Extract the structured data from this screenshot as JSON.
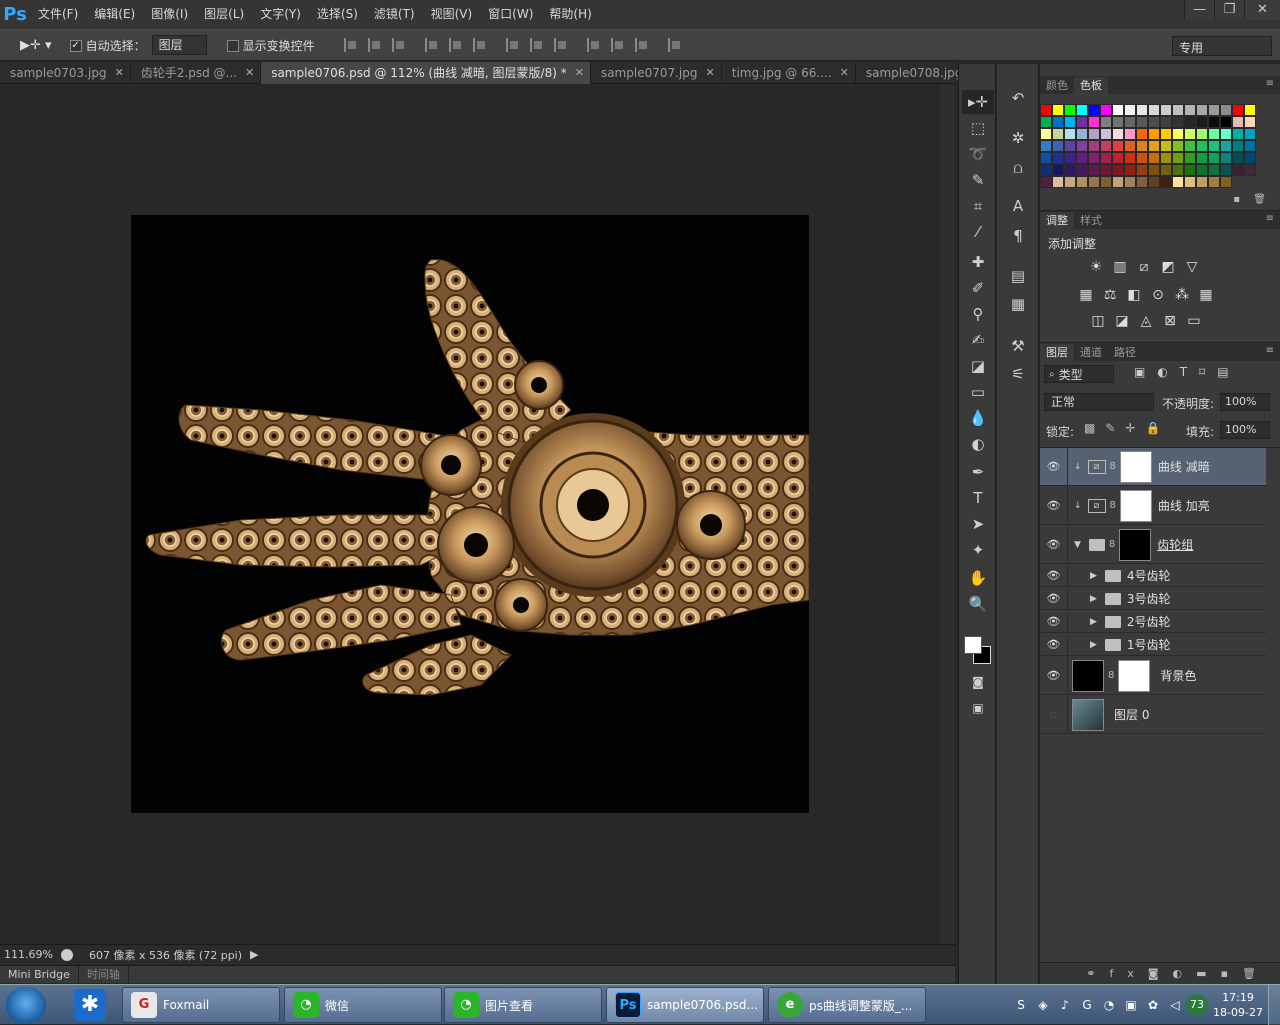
{
  "app": {
    "logo": "Ps"
  },
  "menu": [
    "文件(F)",
    "编辑(E)",
    "图像(I)",
    "图层(L)",
    "文字(Y)",
    "选择(S)",
    "滤镜(T)",
    "视图(V)",
    "窗口(W)",
    "帮助(H)"
  ],
  "window_controls": {
    "minimize": "—",
    "restore": "❐",
    "close": "✕"
  },
  "options": {
    "auto_select_label": "自动选择：",
    "auto_select_value": "图层",
    "show_transform_label": "显示变换控件",
    "workspace": "专用"
  },
  "tabs": [
    {
      "label": "sample0703.jpg",
      "active": false
    },
    {
      "label": "齿轮手2.psd @...",
      "active": false
    },
    {
      "label": "sample0706.psd @ 112% (曲线 减暗, 图层蒙版/8) *",
      "active": true
    },
    {
      "label": "sample0707.jpg",
      "active": false
    },
    {
      "label": "timg.jpg @ 66....",
      "active": false
    },
    {
      "label": "sample0708.jpg",
      "active": false
    }
  ],
  "status": {
    "zoom": "111.69%",
    "doc_size": "607 像素 x 536 像素 (72 ppi)"
  },
  "bottom_tabs": [
    "Mini Bridge",
    "时间轴"
  ],
  "panels": {
    "color_tabs": [
      "颜色",
      "色板"
    ],
    "adjust_tabs": [
      "调整",
      "样式"
    ],
    "adjust_title": "添加调整",
    "layer_tabs": [
      "图层",
      "通道",
      "路径"
    ],
    "filter_kind": "类型",
    "blend_mode": "正常",
    "opacity_label": "不透明度:",
    "opacity_value": "100%",
    "lock_label": "锁定:",
    "fill_label": "填充:",
    "fill_value": "100%"
  },
  "swatch_colors": [
    "#ff0000",
    "#ffff00",
    "#00ff00",
    "#00ffff",
    "#0000ff",
    "#ff00ff",
    "#ffffff",
    "#f2f2f2",
    "#e6e6e6",
    "#d9d9d9",
    "#cccccc",
    "#bfbfbf",
    "#b3b3b3",
    "#a6a6a6",
    "#999999",
    "#8c8c8c",
    "#ff0000",
    "#ffff00",
    "#00b050",
    "#0070c0",
    "#00b0f0",
    "#7030a0",
    "#ff33cc",
    "#808080",
    "#737373",
    "#666666",
    "#595959",
    "#4d4d4d",
    "#404040",
    "#333333",
    "#262626",
    "#1a1a1a",
    "#0d0d0d",
    "#000000",
    "#e6b8b7",
    "#fcd5b4",
    "#ffff99",
    "#c4d79b",
    "#b7dee8",
    "#95b3d7",
    "#b1a0c7",
    "#ccc0da",
    "#f2dcdb",
    "#ff99cc",
    "#ff6600",
    "#ff9900",
    "#ffcc00",
    "#ffff66",
    "#ccff66",
    "#99ff66",
    "#66ff99",
    "#66ffcc",
    "#00b0a0",
    "#00a0c0",
    "#3080c0",
    "#4060b0",
    "#6040a0",
    "#8040a0",
    "#a04080",
    "#c04060",
    "#e04040",
    "#e06020",
    "#e08020",
    "#e0a020",
    "#c0c020",
    "#80c020",
    "#40c040",
    "#20c060",
    "#20c080",
    "#20a0a0",
    "#008080",
    "#0070a0",
    "#1050a0",
    "#203090",
    "#402090",
    "#602080",
    "#802070",
    "#a02050",
    "#c02030",
    "#d03010",
    "#d05010",
    "#c07010",
    "#a09010",
    "#70a010",
    "#30a020",
    "#10a040",
    "#10a060",
    "#108080",
    "#005050",
    "#004870",
    "#103070",
    "#181860",
    "#301860",
    "#481860",
    "#601850",
    "#701830",
    "#801820",
    "#902010",
    "#904010",
    "#805010",
    "#706010",
    "#507010",
    "#207010",
    "#107030",
    "#107040",
    "#105050",
    "#3a2030",
    "#402838",
    "#502040",
    "#d9c0a0",
    "#c8a880",
    "#b09060",
    "#987848",
    "#806030",
    "#c0a080",
    "#a08060",
    "#806040",
    "#604020",
    "#402010",
    "#ffe0a0",
    "#e0c080",
    "#c0a060",
    "#a08040",
    "#806020"
  ],
  "layers": [
    {
      "name": "曲线 减暗",
      "type": "curves",
      "selected": true,
      "visible": true
    },
    {
      "name": "曲线 加亮",
      "type": "curves",
      "selected": false,
      "visible": true
    },
    {
      "name": "齿轮组",
      "type": "group-mask",
      "selected": false,
      "visible": true
    },
    {
      "name": "4号齿轮",
      "type": "folder",
      "selected": false,
      "visible": true
    },
    {
      "name": "3号齿轮",
      "type": "folder",
      "selected": false,
      "visible": true
    },
    {
      "name": "2号齿轮",
      "type": "folder",
      "selected": false,
      "visible": true
    },
    {
      "name": "1号齿轮",
      "type": "folder",
      "selected": false,
      "visible": true
    },
    {
      "name": "背景色",
      "type": "fill",
      "selected": false,
      "visible": true
    },
    {
      "name": "图层 0",
      "type": "image",
      "selected": false,
      "visible": false
    }
  ],
  "taskbar": {
    "items": [
      {
        "label": "Foxmail",
        "active": false
      },
      {
        "label": "微信",
        "active": false
      },
      {
        "label": "图片查看",
        "active": false
      },
      {
        "label": "sample0706.psd...",
        "active": true
      },
      {
        "label": "ps曲线调整蒙版_...",
        "active": false
      }
    ],
    "tray_badge": "73",
    "time": "17:19",
    "date": "18-09-27"
  }
}
